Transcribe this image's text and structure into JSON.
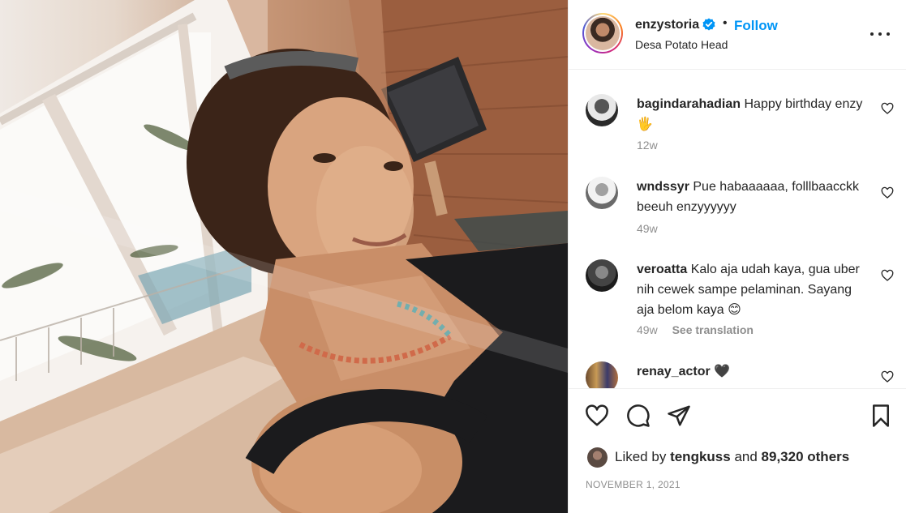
{
  "post": {
    "username": "enzystoria",
    "location": "Desa Potato Head",
    "follow_label": "Follow",
    "separator": "•",
    "verified_icon": "verified-badge-icon",
    "more_icon": "more-options-icon"
  },
  "comments": [
    {
      "user": "bagindarahadian",
      "text": "Happy birthday enzy 🖐",
      "time": "12w",
      "translate": ""
    },
    {
      "user": "wndssyr",
      "text": "Pue habaaaaaa, folllbaacckk beeuh enzyyyyyy",
      "time": "49w",
      "translate": ""
    },
    {
      "user": "veroatta",
      "text": "Kalo aja udah kaya, gua uber nih cewek sampe pelaminan. Sayang aja belom kaya 😊",
      "time": "49w",
      "translate": "See translation"
    },
    {
      "user": "renay_actor",
      "text": "🖤",
      "time": "",
      "translate": ""
    }
  ],
  "actions": {
    "like_icon": "heart-icon",
    "comment_icon": "comment-icon",
    "share_icon": "share-icon",
    "save_icon": "bookmark-icon"
  },
  "likes": {
    "prefix": "Liked by",
    "user": "tengkuss",
    "middle": "and",
    "others": "89,320 others"
  },
  "date": "NOVEMBER 1, 2021",
  "colors": {
    "accent": "#0095f6",
    "text": "#262626",
    "muted": "#8e8e8e",
    "border": "#efefef"
  }
}
